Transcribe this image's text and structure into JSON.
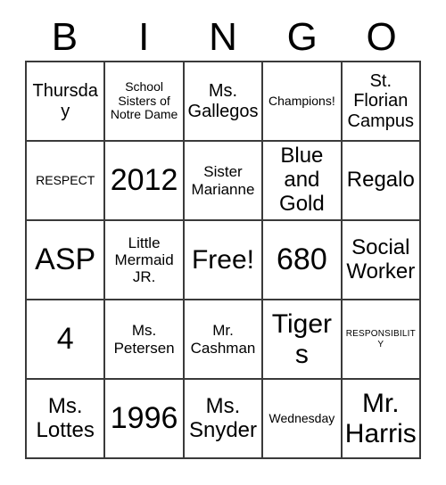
{
  "card": {
    "title": "BINGO Card",
    "header": {
      "letters": [
        "B",
        "I",
        "N",
        "G",
        "O"
      ]
    },
    "rows": [
      [
        {
          "text": "Thursday",
          "size": "md"
        },
        {
          "text": "School Sisters of Notre Dame",
          "size": "xs"
        },
        {
          "text": "Ms. Gallegos",
          "size": "md"
        },
        {
          "text": "Champions!",
          "size": "xs"
        },
        {
          "text": "St. Florian Campus",
          "size": "md"
        }
      ],
      [
        {
          "text": "RESPECT",
          "size": "xs"
        },
        {
          "text": "2012",
          "size": "xxl"
        },
        {
          "text": "Sister Marianne",
          "size": "sm"
        },
        {
          "text": "Blue and Gold",
          "size": "lg"
        },
        {
          "text": "Regalo",
          "size": "lg"
        }
      ],
      [
        {
          "text": "ASP",
          "size": "xxl"
        },
        {
          "text": "Little Mermaid JR.",
          "size": "sm"
        },
        {
          "text": "Free!",
          "size": "xl"
        },
        {
          "text": "680",
          "size": "xxl"
        },
        {
          "text": "Social Worker",
          "size": "lg"
        }
      ],
      [
        {
          "text": "4",
          "size": "xxl"
        },
        {
          "text": "Ms. Petersen",
          "size": "sm"
        },
        {
          "text": "Mr. Cashman",
          "size": "sm"
        },
        {
          "text": "Tigers",
          "size": "xl"
        },
        {
          "text": "RESPONSIBILITY",
          "size": "xxs"
        }
      ],
      [
        {
          "text": "Ms. Lottes",
          "size": "lg"
        },
        {
          "text": "1996",
          "size": "xxl"
        },
        {
          "text": "Ms. Snyder",
          "size": "lg"
        },
        {
          "text": "Wednesday",
          "size": "xs"
        },
        {
          "text": "Mr. Harris",
          "size": "xl"
        }
      ]
    ],
    "colors": {
      "grid_line": "#3a3a3a",
      "text": "#000000",
      "background": "#ffffff"
    }
  }
}
